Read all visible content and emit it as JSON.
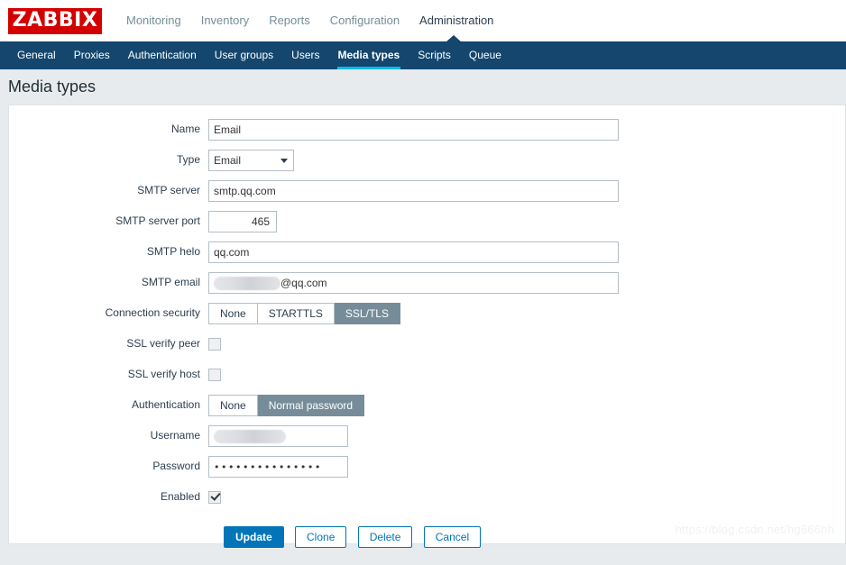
{
  "header": {
    "logo_text": "ZABBIX",
    "menu": [
      {
        "label": "Monitoring",
        "active": false
      },
      {
        "label": "Inventory",
        "active": false
      },
      {
        "label": "Reports",
        "active": false
      },
      {
        "label": "Configuration",
        "active": false
      },
      {
        "label": "Administration",
        "active": true
      }
    ]
  },
  "subnav": {
    "items": [
      {
        "label": "General",
        "active": false
      },
      {
        "label": "Proxies",
        "active": false
      },
      {
        "label": "Authentication",
        "active": false
      },
      {
        "label": "User groups",
        "active": false
      },
      {
        "label": "Users",
        "active": false
      },
      {
        "label": "Media types",
        "active": true
      },
      {
        "label": "Scripts",
        "active": false
      },
      {
        "label": "Queue",
        "active": false
      }
    ],
    "active_underline_color": "#0bb9f0"
  },
  "page": {
    "title": "Media types",
    "watermark": "https://blog.csdn.net/hg666hh"
  },
  "form": {
    "labels": {
      "name": "Name",
      "type": "Type",
      "smtp_server": "SMTP server",
      "smtp_server_port": "SMTP server port",
      "smtp_helo": "SMTP helo",
      "smtp_email": "SMTP email",
      "connection_security": "Connection security",
      "ssl_verify_peer": "SSL verify peer",
      "ssl_verify_host": "SSL verify host",
      "authentication": "Authentication",
      "username": "Username",
      "password": "Password",
      "enabled": "Enabled"
    },
    "values": {
      "name": "Email",
      "type": "Email",
      "smtp_server": "smtp.qq.com",
      "smtp_server_port": "465",
      "smtp_helo": "qq.com",
      "smtp_email_suffix": "@qq.com",
      "password_masked": "•••••••••••••••"
    },
    "connection_security_options": [
      {
        "label": "None",
        "selected": false
      },
      {
        "label": "STARTTLS",
        "selected": false
      },
      {
        "label": "SSL/TLS",
        "selected": true
      }
    ],
    "authentication_options": [
      {
        "label": "None",
        "selected": false
      },
      {
        "label": "Normal password",
        "selected": true
      }
    ],
    "checkboxes": {
      "ssl_verify_peer_checked": false,
      "ssl_verify_host_checked": false,
      "enabled_checked": true
    },
    "buttons": [
      {
        "label": "Update",
        "style": "primary"
      },
      {
        "label": "Clone",
        "style": "default"
      },
      {
        "label": "Delete",
        "style": "default"
      },
      {
        "label": "Cancel",
        "style": "default"
      }
    ]
  },
  "colors": {
    "brand_red": "#d40000",
    "subnav_bg": "#14466e",
    "accent_blue": "#0275b8",
    "segment_selected": "#768d99",
    "page_bg": "#e8ebee"
  }
}
